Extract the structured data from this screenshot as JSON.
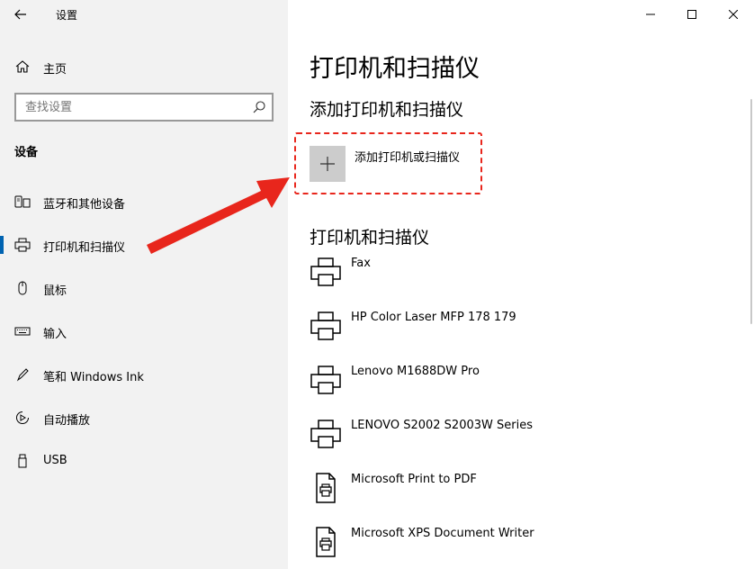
{
  "window": {
    "title": "设置"
  },
  "sidebar": {
    "home_label": "主页",
    "search_placeholder": "查找设置",
    "section_title": "设备",
    "items": [
      {
        "label": "蓝牙和其他设备",
        "icon": "bluetooth-devices-icon"
      },
      {
        "label": "打印机和扫描仪",
        "icon": "printer-icon",
        "selected": true
      },
      {
        "label": "鼠标",
        "icon": "mouse-icon"
      },
      {
        "label": "输入",
        "icon": "keyboard-icon"
      },
      {
        "label": "笔和 Windows Ink",
        "icon": "pen-icon"
      },
      {
        "label": "自动播放",
        "icon": "autoplay-icon"
      },
      {
        "label": "USB",
        "icon": "usb-icon"
      }
    ]
  },
  "main": {
    "title": "打印机和扫描仪",
    "add_section_heading": "添加打印机和扫描仪",
    "add_button_label": "添加打印机或扫描仪",
    "list_heading": "打印机和扫描仪",
    "devices": [
      {
        "label": "Fax",
        "icon": "printer-icon"
      },
      {
        "label": "HP Color Laser MFP 178 179",
        "icon": "printer-icon"
      },
      {
        "label": "Lenovo M1688DW Pro",
        "icon": "printer-icon"
      },
      {
        "label": "LENOVO S2002 S2003W Series",
        "icon": "printer-icon"
      },
      {
        "label": "Microsoft Print to PDF",
        "icon": "document-printer-icon"
      },
      {
        "label": "Microsoft XPS Document Writer",
        "icon": "document-printer-icon"
      }
    ]
  },
  "colors": {
    "sidebar_bg": "#f2f2f2",
    "accent": "#0063b1",
    "annotation_red": "#e8261c",
    "tile_gray": "#cccccc"
  }
}
